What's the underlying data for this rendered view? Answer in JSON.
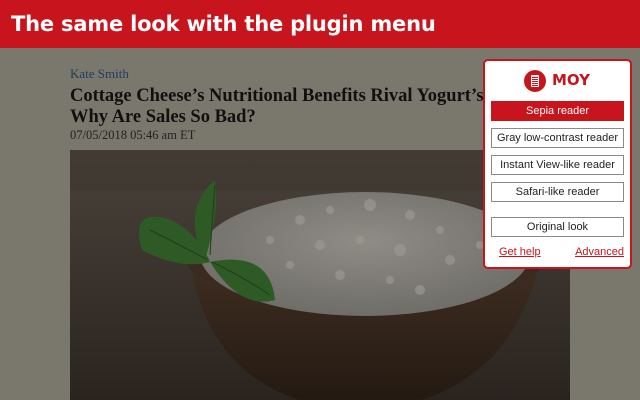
{
  "banner": {
    "title": "The same look with the plugin menu"
  },
  "article": {
    "author": "Kate Smith",
    "headline_line1": "Cottage Cheese’s Nutritional Benefits Rival Yogurt’s",
    "headline_line2": "Why Are Sales So Bad?",
    "date": "07/05/2018 05:46 am ET"
  },
  "plugin": {
    "brand": "MOY",
    "icon": "document-icon",
    "accent_color": "#c8141c",
    "modes": [
      {
        "label": "Sepia reader",
        "active": true
      },
      {
        "label": "Gray low-contrast reader",
        "active": false
      },
      {
        "label": "Instant View-like reader",
        "active": false
      },
      {
        "label": "Safari-like reader",
        "active": false
      },
      {
        "label": "Original look",
        "active": false
      }
    ],
    "links": {
      "help": "Get help",
      "advanced": "Advanced"
    }
  }
}
